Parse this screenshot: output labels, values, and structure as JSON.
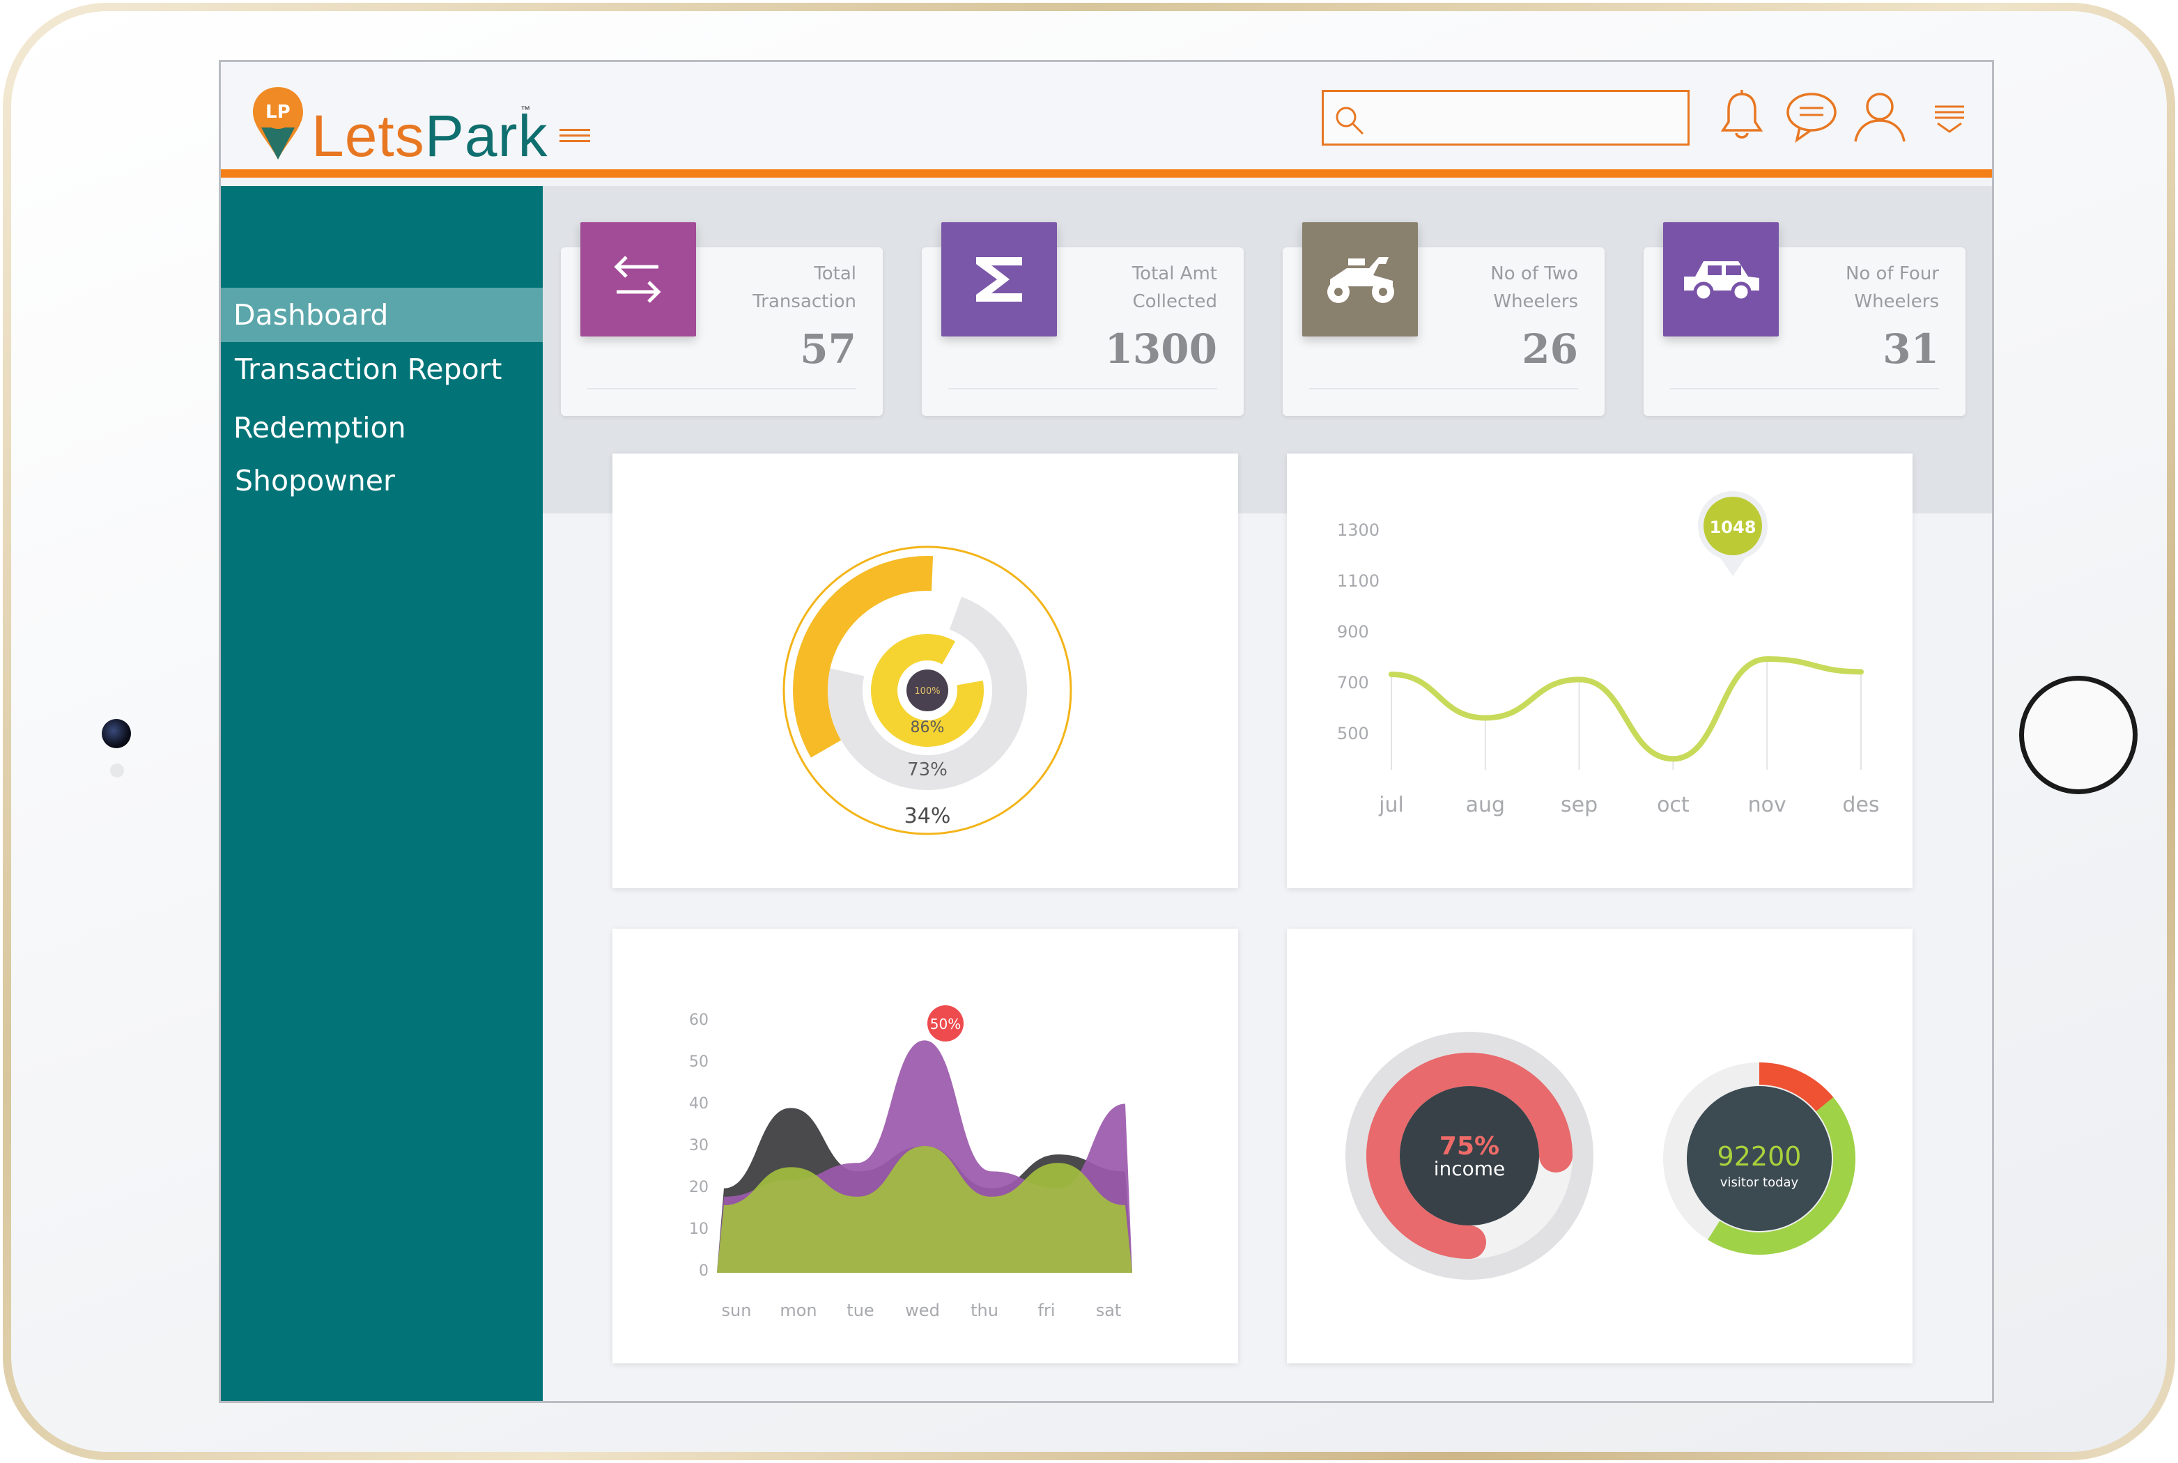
{
  "app": {
    "logo_part1": "Lets",
    "logo_part2": "Park",
    "trademark": "™"
  },
  "header": {
    "search_placeholder": "",
    "search_value": ""
  },
  "sidebar": {
    "items": [
      {
        "label": "Dashboard",
        "active": true
      },
      {
        "label": "Transaction Report",
        "active": false
      },
      {
        "label": "Redemption",
        "active": false
      },
      {
        "label": "Shopowner",
        "active": false
      }
    ]
  },
  "cards": [
    {
      "label_line1": "Total",
      "label_line2": "Transaction",
      "value": "57",
      "tile_color": "#a24b97",
      "icon": "arrows-exchange-icon"
    },
    {
      "label_line1": "Total Amt",
      "label_line2": "Collected",
      "value": "1300",
      "tile_color": "#7a57a8",
      "icon": "sigma-icon"
    },
    {
      "label_line1": "No of Two",
      "label_line2": "Wheelers",
      "value": "26",
      "tile_color": "#8a806e",
      "icon": "quad-bike-icon"
    },
    {
      "label_line1": "No of Four",
      "label_line2": "Wheelers",
      "value": "31",
      "tile_color": "#7853a7",
      "icon": "car-icon"
    }
  ],
  "charts": {
    "radial": {
      "labels": [
        "100%",
        "86%",
        "73%",
        "34%"
      ]
    },
    "line": {
      "yticks": [
        "1300",
        "1100",
        "900",
        "700",
        "500"
      ],
      "xticks": [
        "jul",
        "aug",
        "sep",
        "oct",
        "nov",
        "des"
      ],
      "callout": "1048"
    },
    "area": {
      "yticks": [
        "60",
        "50",
        "40",
        "30",
        "20",
        "10",
        "0"
      ],
      "xticks": [
        "sun",
        "mon",
        "tue",
        "wed",
        "thu",
        "fri",
        "sat"
      ],
      "callout": "50%"
    },
    "donuts": {
      "income_value": "75%",
      "income_label": "income",
      "visitor_value": "92200",
      "visitor_label": "visitor today"
    }
  },
  "chart_data": [
    {
      "type": "radial-bar",
      "series": [
        {
          "label": "100%",
          "value": 100
        },
        {
          "label": "86%",
          "value": 86
        },
        {
          "label": "73%",
          "value": 73
        },
        {
          "label": "34%",
          "value": 34
        }
      ]
    },
    {
      "type": "line",
      "categories": [
        "jul",
        "aug",
        "sep",
        "oct",
        "nov",
        "des"
      ],
      "values": [
        900,
        730,
        880,
        570,
        960,
        910
      ],
      "ylim": [
        500,
        1300
      ],
      "annotations": [
        {
          "text": "1048",
          "x": "nov"
        }
      ],
      "grid": false
    },
    {
      "type": "area",
      "categories": [
        "sun",
        "mon",
        "tue",
        "wed",
        "thu",
        "fri",
        "sat"
      ],
      "series": [
        {
          "color": "#3b3b3d",
          "values": [
            20,
            39,
            24,
            30,
            20,
            28,
            24
          ]
        },
        {
          "color": "#9b59ab",
          "values": [
            18,
            22,
            26,
            55,
            24,
            20,
            40
          ]
        },
        {
          "color": "#a3c03e",
          "values": [
            16,
            25,
            18,
            30,
            18,
            26,
            16
          ]
        }
      ],
      "ylim": [
        0,
        60
      ],
      "annotations": [
        {
          "text": "50%",
          "x": "wed"
        }
      ]
    },
    {
      "type": "pie",
      "values": [
        75,
        25
      ],
      "colors": [
        "#e86a6c",
        "#f0f0f0"
      ],
      "center_text": "75%",
      "center_label": "income"
    },
    {
      "type": "pie",
      "values": [
        14,
        45,
        41
      ],
      "colors": [
        "#ee5233",
        "#9fd246",
        "#f0f0f0"
      ],
      "center_text": "92200",
      "center_label": "visitor today"
    }
  ]
}
